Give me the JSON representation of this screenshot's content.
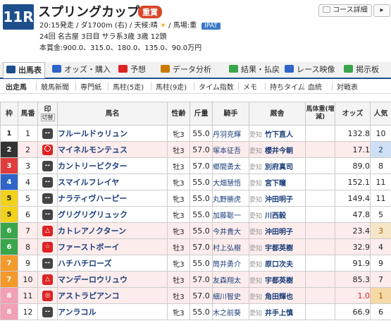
{
  "race": {
    "number": "11R",
    "name": "スプリングカップ",
    "grade": "重賞",
    "line1": "20:15発走 / ダ1700m (右) / 天候:晴",
    "line1b": "/ 馬場:重",
    "ipat": "IPAT",
    "line2": "24回 名古屋 3日目 サラ系3歳 3歳 12頭",
    "line3": "本賞金:900.0、315.0、180.0、135.0、90.0万円",
    "course_button": "コース詳細"
  },
  "tabs": [
    {
      "label": "出馬表",
      "icon": "table-icon"
    },
    {
      "label": "オッズ・購入",
      "icon": "chart-icon"
    },
    {
      "label": "予想",
      "icon": "target-icon"
    },
    {
      "label": "データ分析",
      "icon": "data-icon"
    },
    {
      "label": "結果・払戻",
      "icon": "result-icon"
    },
    {
      "label": "レース映像",
      "icon": "video-icon"
    },
    {
      "label": "掲示板",
      "icon": "board-icon"
    }
  ],
  "subnav": [
    "出走馬",
    "競馬新聞",
    "専門紙",
    "馬柱(5走)",
    "馬柱(9走)",
    "タイム指数",
    "メモ",
    "持ちタイム",
    "血統",
    "対戦表"
  ],
  "columns": {
    "waku": "枠",
    "umaban": "馬番",
    "mark": "印",
    "mark_sub": "切替",
    "name": "馬名",
    "sex": "性齢",
    "kin": "斤量",
    "jockey": "騎手",
    "trainer": "厩舎",
    "weight": "馬体重(増減)",
    "odds": "オッズ",
    "pop": "人気"
  },
  "waku_colors": {
    "1": {
      "bg": "#ffffff",
      "fg": "#222222"
    },
    "2": {
      "bg": "#333333",
      "fg": "#ffffff"
    },
    "3": {
      "bg": "#e03c3c",
      "fg": "#ffffff"
    },
    "4": {
      "bg": "#2f64c8",
      "fg": "#ffffff"
    },
    "5": {
      "bg": "#f2d21a",
      "fg": "#222222"
    },
    "6": {
      "bg": "#3aa54a",
      "fg": "#ffffff"
    },
    "7": {
      "bg": "#f39a2a",
      "fg": "#ffffff"
    },
    "8": {
      "bg": "#f39fb4",
      "fg": "#ffffff"
    }
  },
  "runners": [
    {
      "waku": "1",
      "umaban": "1",
      "mark": "dash",
      "name": "フルールドゥリュン",
      "sex": "牝3",
      "kin": "55.0",
      "jockey": "丹羽克輝",
      "area": "愛知",
      "trainer": "竹下直人",
      "odds": "132.8",
      "pop": "10",
      "hl": false
    },
    {
      "waku": "2",
      "umaban": "2",
      "mark": "circle",
      "name": "マイネルモンテュス",
      "sex": "牡3",
      "kin": "57.0",
      "jockey": "塚本征吾",
      "area": "愛知",
      "trainer": "櫻井今朝",
      "odds": "17.1",
      "pop": "2",
      "hl": true
    },
    {
      "waku": "3",
      "umaban": "3",
      "mark": "dash",
      "name": "カントリービクター",
      "sex": "牡3",
      "kin": "57.0",
      "jockey": "郷間勇太",
      "area": "愛知",
      "trainer": "別府真司",
      "odds": "89.0",
      "pop": "8",
      "hl": false
    },
    {
      "waku": "4",
      "umaban": "4",
      "mark": "dash",
      "name": "スマイルフレイヤ",
      "sex": "牝3",
      "kin": "55.0",
      "jockey": "大畑慧悟",
      "area": "愛知",
      "trainer": "宮下瞳",
      "odds": "152.1",
      "pop": "11",
      "hl": false
    },
    {
      "waku": "5",
      "umaban": "5",
      "mark": "dash",
      "name": "ナラティヴハーピー",
      "sex": "牝3",
      "kin": "55.0",
      "jockey": "丸野勝虎",
      "area": "愛知",
      "trainer": "沖田明子",
      "odds": "149.4",
      "pop": "11",
      "hl": false
    },
    {
      "waku": "5",
      "umaban": "6",
      "mark": "dash",
      "name": "グリグリグリュック",
      "sex": "牝3",
      "kin": "55.0",
      "jockey": "加藤聡一",
      "area": "愛知",
      "trainer": "川西毅",
      "odds": "47.8",
      "pop": "5",
      "hl": false
    },
    {
      "waku": "6",
      "umaban": "7",
      "mark": "triangle",
      "name": "カトレアノクターン",
      "sex": "牝3",
      "kin": "55.0",
      "jockey": "今井貴大",
      "area": "愛知",
      "trainer": "沖田明子",
      "odds": "23.4",
      "pop": "3",
      "hl": true
    },
    {
      "waku": "6",
      "umaban": "8",
      "mark": "star",
      "name": "ファーストボーイ",
      "sex": "牡3",
      "kin": "57.0",
      "jockey": "村上弘樹",
      "area": "愛知",
      "trainer": "宇都英樹",
      "odds": "32.9",
      "pop": "4",
      "hl": true
    },
    {
      "waku": "7",
      "umaban": "9",
      "mark": "dash",
      "name": "ハチハチローズ",
      "sex": "牝3",
      "kin": "55.0",
      "jockey": "筒井勇介",
      "area": "愛知",
      "trainer": "原口次夫",
      "odds": "91.9",
      "pop": "9",
      "hl": false
    },
    {
      "waku": "7",
      "umaban": "10",
      "mark": "triangle",
      "name": "マンデーロウリュウ",
      "sex": "牡3",
      "kin": "57.0",
      "jockey": "友森翔太",
      "area": "愛知",
      "trainer": "宇都英樹",
      "odds": "85.3",
      "pop": "7",
      "hl": true
    },
    {
      "waku": "8",
      "umaban": "11",
      "mark": "double",
      "name": "アストラピアンコ",
      "sex": "牡3",
      "kin": "57.0",
      "jockey": "細川智史",
      "area": "愛知",
      "trainer": "角田輝也",
      "odds": "1.0",
      "pop": "1",
      "hl": true
    },
    {
      "waku": "8",
      "umaban": "12",
      "mark": "dash",
      "name": "アンラコル",
      "sex": "牝3",
      "kin": "55.0",
      "jockey": "木之前葵",
      "area": "愛知",
      "trainer": "井手上慎",
      "odds": "66.9",
      "pop": "6",
      "hl": false
    }
  ]
}
